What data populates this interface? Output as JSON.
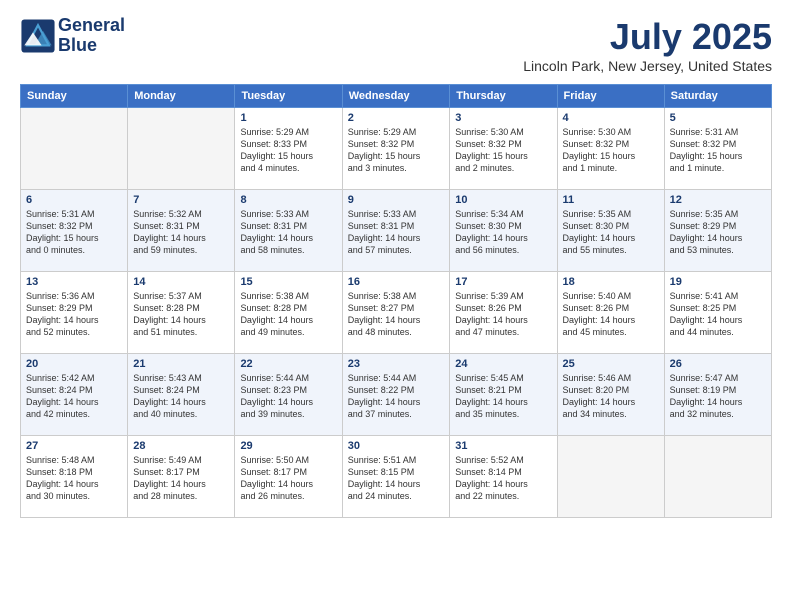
{
  "logo": {
    "line1": "General",
    "line2": "Blue"
  },
  "title": "July 2025",
  "subtitle": "Lincoln Park, New Jersey, United States",
  "weekdays": [
    "Sunday",
    "Monday",
    "Tuesday",
    "Wednesday",
    "Thursday",
    "Friday",
    "Saturday"
  ],
  "weeks": [
    [
      {
        "day": "",
        "info": ""
      },
      {
        "day": "",
        "info": ""
      },
      {
        "day": "1",
        "info": "Sunrise: 5:29 AM\nSunset: 8:33 PM\nDaylight: 15 hours\nand 4 minutes."
      },
      {
        "day": "2",
        "info": "Sunrise: 5:29 AM\nSunset: 8:32 PM\nDaylight: 15 hours\nand 3 minutes."
      },
      {
        "day": "3",
        "info": "Sunrise: 5:30 AM\nSunset: 8:32 PM\nDaylight: 15 hours\nand 2 minutes."
      },
      {
        "day": "4",
        "info": "Sunrise: 5:30 AM\nSunset: 8:32 PM\nDaylight: 15 hours\nand 1 minute."
      },
      {
        "day": "5",
        "info": "Sunrise: 5:31 AM\nSunset: 8:32 PM\nDaylight: 15 hours\nand 1 minute."
      }
    ],
    [
      {
        "day": "6",
        "info": "Sunrise: 5:31 AM\nSunset: 8:32 PM\nDaylight: 15 hours\nand 0 minutes."
      },
      {
        "day": "7",
        "info": "Sunrise: 5:32 AM\nSunset: 8:31 PM\nDaylight: 14 hours\nand 59 minutes."
      },
      {
        "day": "8",
        "info": "Sunrise: 5:33 AM\nSunset: 8:31 PM\nDaylight: 14 hours\nand 58 minutes."
      },
      {
        "day": "9",
        "info": "Sunrise: 5:33 AM\nSunset: 8:31 PM\nDaylight: 14 hours\nand 57 minutes."
      },
      {
        "day": "10",
        "info": "Sunrise: 5:34 AM\nSunset: 8:30 PM\nDaylight: 14 hours\nand 56 minutes."
      },
      {
        "day": "11",
        "info": "Sunrise: 5:35 AM\nSunset: 8:30 PM\nDaylight: 14 hours\nand 55 minutes."
      },
      {
        "day": "12",
        "info": "Sunrise: 5:35 AM\nSunset: 8:29 PM\nDaylight: 14 hours\nand 53 minutes."
      }
    ],
    [
      {
        "day": "13",
        "info": "Sunrise: 5:36 AM\nSunset: 8:29 PM\nDaylight: 14 hours\nand 52 minutes."
      },
      {
        "day": "14",
        "info": "Sunrise: 5:37 AM\nSunset: 8:28 PM\nDaylight: 14 hours\nand 51 minutes."
      },
      {
        "day": "15",
        "info": "Sunrise: 5:38 AM\nSunset: 8:28 PM\nDaylight: 14 hours\nand 49 minutes."
      },
      {
        "day": "16",
        "info": "Sunrise: 5:38 AM\nSunset: 8:27 PM\nDaylight: 14 hours\nand 48 minutes."
      },
      {
        "day": "17",
        "info": "Sunrise: 5:39 AM\nSunset: 8:26 PM\nDaylight: 14 hours\nand 47 minutes."
      },
      {
        "day": "18",
        "info": "Sunrise: 5:40 AM\nSunset: 8:26 PM\nDaylight: 14 hours\nand 45 minutes."
      },
      {
        "day": "19",
        "info": "Sunrise: 5:41 AM\nSunset: 8:25 PM\nDaylight: 14 hours\nand 44 minutes."
      }
    ],
    [
      {
        "day": "20",
        "info": "Sunrise: 5:42 AM\nSunset: 8:24 PM\nDaylight: 14 hours\nand 42 minutes."
      },
      {
        "day": "21",
        "info": "Sunrise: 5:43 AM\nSunset: 8:24 PM\nDaylight: 14 hours\nand 40 minutes."
      },
      {
        "day": "22",
        "info": "Sunrise: 5:44 AM\nSunset: 8:23 PM\nDaylight: 14 hours\nand 39 minutes."
      },
      {
        "day": "23",
        "info": "Sunrise: 5:44 AM\nSunset: 8:22 PM\nDaylight: 14 hours\nand 37 minutes."
      },
      {
        "day": "24",
        "info": "Sunrise: 5:45 AM\nSunset: 8:21 PM\nDaylight: 14 hours\nand 35 minutes."
      },
      {
        "day": "25",
        "info": "Sunrise: 5:46 AM\nSunset: 8:20 PM\nDaylight: 14 hours\nand 34 minutes."
      },
      {
        "day": "26",
        "info": "Sunrise: 5:47 AM\nSunset: 8:19 PM\nDaylight: 14 hours\nand 32 minutes."
      }
    ],
    [
      {
        "day": "27",
        "info": "Sunrise: 5:48 AM\nSunset: 8:18 PM\nDaylight: 14 hours\nand 30 minutes."
      },
      {
        "day": "28",
        "info": "Sunrise: 5:49 AM\nSunset: 8:17 PM\nDaylight: 14 hours\nand 28 minutes."
      },
      {
        "day": "29",
        "info": "Sunrise: 5:50 AM\nSunset: 8:17 PM\nDaylight: 14 hours\nand 26 minutes."
      },
      {
        "day": "30",
        "info": "Sunrise: 5:51 AM\nSunset: 8:15 PM\nDaylight: 14 hours\nand 24 minutes."
      },
      {
        "day": "31",
        "info": "Sunrise: 5:52 AM\nSunset: 8:14 PM\nDaylight: 14 hours\nand 22 minutes."
      },
      {
        "day": "",
        "info": ""
      },
      {
        "day": "",
        "info": ""
      }
    ]
  ]
}
